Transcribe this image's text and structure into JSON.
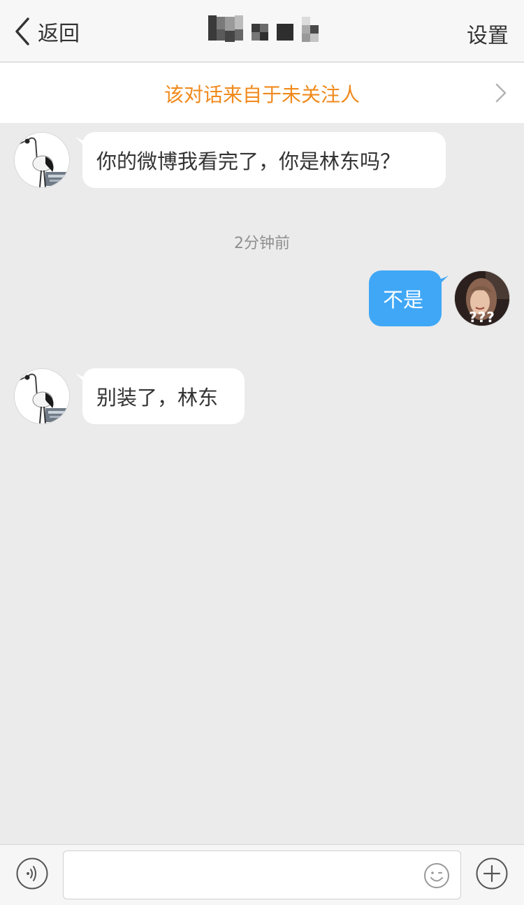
{
  "navbar": {
    "back_label": "返回",
    "settings_label": "设置",
    "title_pixelated": true
  },
  "banner": {
    "text": "该对话来自于未关注人",
    "text_color": "#f08a1c"
  },
  "messages": [
    {
      "side": "left",
      "text": "你的微博我看完了，你是林东吗？",
      "avatar": "crane-avatar"
    },
    {
      "side": "right",
      "text": "不是",
      "avatar": "user-avatar"
    },
    {
      "side": "left",
      "text": "别装了，林东",
      "avatar": "crane-avatar"
    }
  ],
  "timestamp": "2分钟前",
  "self_avatar_overlay": "???",
  "input": {
    "placeholder": "",
    "value": ""
  },
  "colors": {
    "background": "#ebebeb",
    "right_bubble": "#3fa7f6",
    "left_bubble": "#ffffff"
  },
  "icons": {
    "back": "chevron-left-icon",
    "banner_arrow": "chevron-right-icon",
    "voice": "voice-icon",
    "emoji": "emoji-icon",
    "plus": "plus-icon"
  }
}
